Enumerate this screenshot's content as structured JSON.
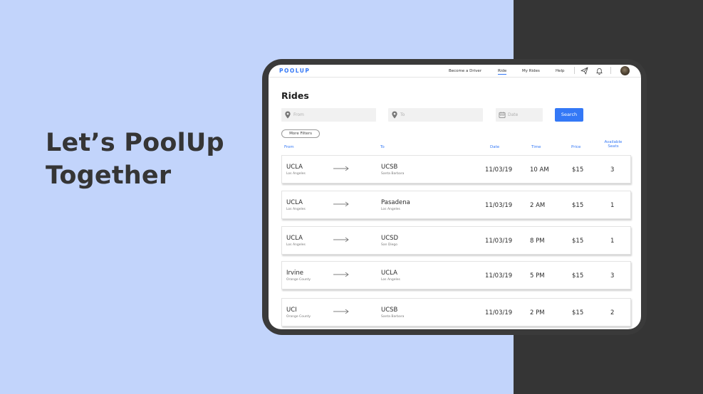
{
  "headline": {
    "line1": "Let’s PoolUp",
    "line2": "Together"
  },
  "app": {
    "logo": "POOLUP",
    "nav": {
      "become_driver": "Become a Driver",
      "ride": "Ride",
      "my_rides": "My Rides",
      "help": "Help"
    },
    "page_title": "Rides",
    "search": {
      "from_placeholder": "From",
      "to_placeholder": "To",
      "date_placeholder": "Date",
      "button": "Search"
    },
    "more_filters": "More Filters",
    "columns": {
      "from": "From",
      "to": "To",
      "date": "Date",
      "time": "Time",
      "price": "Price",
      "seats_line1": "Available",
      "seats_line2": "Seats"
    },
    "rides": [
      {
        "from_city": "UCLA",
        "from_region": "Los Angeles",
        "to_city": "UCSB",
        "to_region": "Santa Barbara",
        "date": "11/03/19",
        "time": "10 AM",
        "price": "$15",
        "seats": "3"
      },
      {
        "from_city": "UCLA",
        "from_region": "Los Angeles",
        "to_city": "Pasadena",
        "to_region": "Los Angeles",
        "date": "11/03/19",
        "time": "2 AM",
        "price": "$15",
        "seats": "1"
      },
      {
        "from_city": "UCLA",
        "from_region": "Los Angeles",
        "to_city": "UCSD",
        "to_region": "San Diego",
        "date": "11/03/19",
        "time": "8 PM",
        "price": "$15",
        "seats": "1"
      },
      {
        "from_city": "Irvine",
        "from_region": "Orange County",
        "to_city": "UCLA",
        "to_region": "Los Angeles",
        "date": "11/03/19",
        "time": "5 PM",
        "price": "$15",
        "seats": "3"
      },
      {
        "from_city": "UCI",
        "from_region": "Orange County",
        "to_city": "UCSB",
        "to_region": "Santa Barbara",
        "date": "11/03/19",
        "time": "2 PM",
        "price": "$15",
        "seats": "2"
      }
    ]
  },
  "colors": {
    "accent": "#3478f6",
    "background_left": "#c2d4fb",
    "background_right": "#353535",
    "headline": "#353535"
  },
  "icons": [
    "location-pin-icon",
    "calendar-icon",
    "send-icon",
    "bell-icon",
    "arrow-right-icon"
  ]
}
